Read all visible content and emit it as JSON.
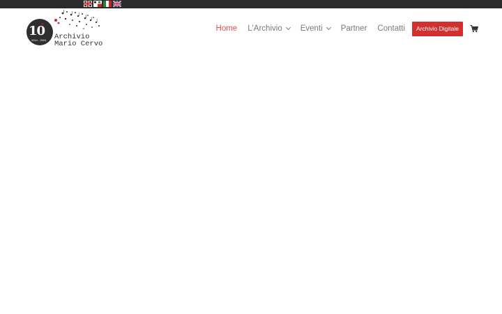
{
  "topbar": {
    "languages": [
      {
        "name": "flag-sardinia-icon"
      },
      {
        "name": "flag-sardinia-alt-icon"
      },
      {
        "name": "flag-italy-icon"
      },
      {
        "name": "flag-uk-icon"
      }
    ]
  },
  "logo": {
    "number": "10",
    "degree": "°",
    "years": "2014 - 2024",
    "line1": "Archivio",
    "line2": "Mario Cervo"
  },
  "nav": {
    "home": "Home",
    "archivio": "L'Archivio",
    "eventi": "Eventi",
    "partner": "Partner",
    "contatti": "Contatti",
    "cta": "Archivio Digitale"
  },
  "colors": {
    "accent": "#d32f2f",
    "active": "#d9534f",
    "topbar": "#2b2b2b",
    "text": "#7a7a7a"
  }
}
